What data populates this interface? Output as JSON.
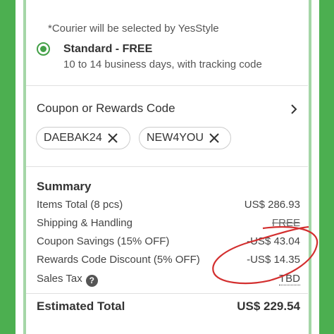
{
  "shipping": {
    "courier_note": "*Courier will be selected by YesStyle",
    "option_title": "Standard - FREE",
    "option_desc": "10 to 14 business days, with tracking code"
  },
  "coupon": {
    "heading": "Coupon or Rewards Code",
    "chips": [
      {
        "code": "DAEBAK24"
      },
      {
        "code": "NEW4YOU"
      }
    ]
  },
  "summary": {
    "title": "Summary",
    "rows": [
      {
        "label": "Items Total (8 pcs)",
        "value": "US$ 286.93"
      },
      {
        "label": "Shipping & Handling",
        "value": "FREE"
      },
      {
        "label": "Coupon Savings (15% OFF)",
        "value": "-US$ 43.04"
      },
      {
        "label": "Rewards Code Discount (5% OFF)",
        "value": "-US$ 14.35"
      },
      {
        "label": "Sales Tax",
        "value": "TBD"
      }
    ],
    "total_label": "Estimated Total",
    "total_value": "US$ 229.54"
  },
  "colors": {
    "background": "#4caf50",
    "accent": "#43a047",
    "annotation": "#d32f2f"
  },
  "icons": {
    "radio": "radio-selected-icon",
    "chevron": "chevron-right-icon",
    "remove": "close-icon",
    "help": "question-circle-icon"
  }
}
